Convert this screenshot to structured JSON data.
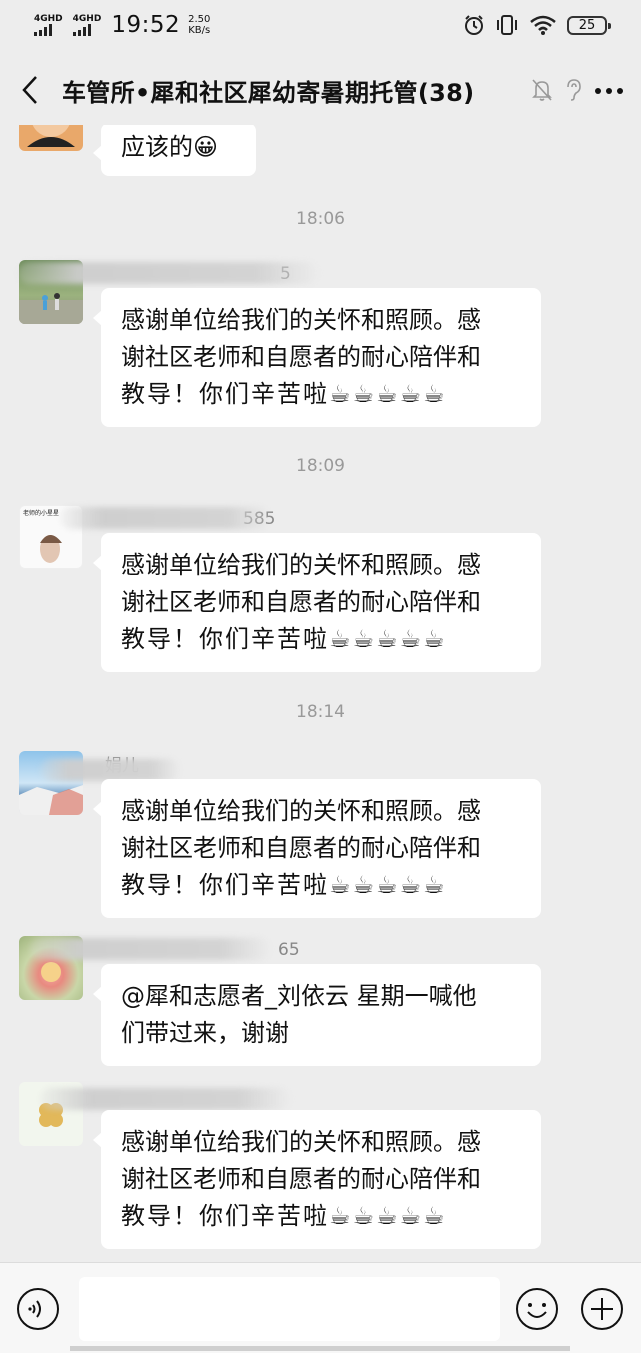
{
  "status_bar": {
    "sim1_label": "4GHD",
    "sim2_label": "4GHD",
    "time": "19:52",
    "net_speed_value": "2.50",
    "net_speed_unit": "KB/s",
    "battery_level": "25"
  },
  "header": {
    "title": "车管所•犀和社区犀幼寄暑期托管(38)"
  },
  "messages": [
    {
      "text": "应该的😀"
    },
    {
      "timestamp": "18:06",
      "sender": "5",
      "line1": "感谢单位给我们的关怀和照顾。感",
      "line2": "谢社区老师和自愿者的耐心陪伴和",
      "line3": "教导！你们辛苦啦☕☕☕☕☕"
    },
    {
      "timestamp": "18:09",
      "sender": "585",
      "avatar_text": "老师的小星星",
      "line1": "感谢单位给我们的关怀和照顾。感",
      "line2": "谢社区老师和自愿者的耐心陪伴和",
      "line3": "教导！你们辛苦啦☕☕☕☕☕"
    },
    {
      "timestamp": "18:14",
      "sender": "娟儿",
      "line1": "感谢单位给我们的关怀和照顾。感",
      "line2": "谢社区老师和自愿者的耐心陪伴和",
      "line3": "教导！你们辛苦啦☕☕☕☕☕"
    },
    {
      "sender": "65",
      "line1": "@犀和志愿者_刘依云  星期一喊他",
      "line2": "们带过来，谢谢"
    },
    {
      "line1": "感谢单位给我们的关怀和照顾。感",
      "line2": "谢社区老师和自愿者的耐心陪伴和",
      "line3": "教导！你们辛苦啦☕☕☕☕☕"
    }
  ],
  "icons": {
    "alarm": "alarm-icon",
    "vibrate": "vibrate-icon",
    "wifi": "wifi-icon",
    "mute": "bell-off-icon",
    "ear": "earpiece-icon",
    "more": "more-icon",
    "voice": "voice-icon",
    "emoji": "emoji-icon",
    "plus": "plus-icon"
  }
}
